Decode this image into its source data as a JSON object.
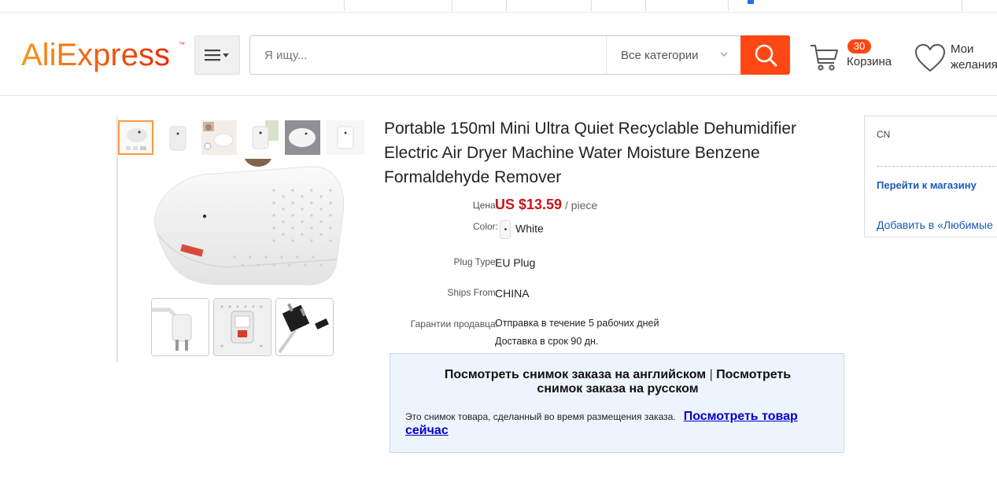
{
  "brand": {
    "logo_text": "AliExpress",
    "logo_mark": "™",
    "colors": {
      "primary": "#ff4713",
      "logo_red": "#e62e04",
      "logo_orange": "#f7971d",
      "price": "#c4161c",
      "link": "#1a5ab8"
    }
  },
  "header": {
    "menu_icon": "hamburger-menu-icon",
    "search": {
      "placeholder": "Я ищу...",
      "value": ""
    },
    "category": {
      "selected": "Все категории"
    },
    "search_button_icon": "search-icon",
    "cart": {
      "count": "30",
      "label": "Корзина",
      "icon": "cart-icon"
    },
    "wishlist": {
      "label_line1": "Мои",
      "label_line2": "желания",
      "icon": "heart-icon"
    }
  },
  "product": {
    "title": "Portable 150ml Mini Ultra Quiet Recyclable Dehumidifier Electric Air Dryer Machine Water Moisture Benzene Formaldehyde Remover",
    "price_label": "Цена:",
    "price": "US $13.59",
    "price_unit": "/ piece",
    "color_label": "Color:",
    "color_value": "White",
    "plug_label": "Plug Type:",
    "plug_value": "EU Plug",
    "ships_label": "Ships From:",
    "ships_value": "CHINA",
    "guarantee_label": "Гарантии продавца:",
    "guarantee_line1": "Отправка в течение 5 рабочих дней",
    "guarantee_line2": "Доставка в срок 90 дн."
  },
  "snapshot": {
    "english_link": "Посмотреть снимок заказа на английском",
    "separator": "|",
    "russian_link": "Посмотреть снимок заказа на русском",
    "note": "Это снимок товара, сделанный во время размещения заказа.",
    "view_now": "Посмотреть товар сейчас"
  },
  "store": {
    "country": "CN",
    "go_to_store": "Перейти к магазину",
    "add_favorite": "Добавить в «Любимые"
  }
}
